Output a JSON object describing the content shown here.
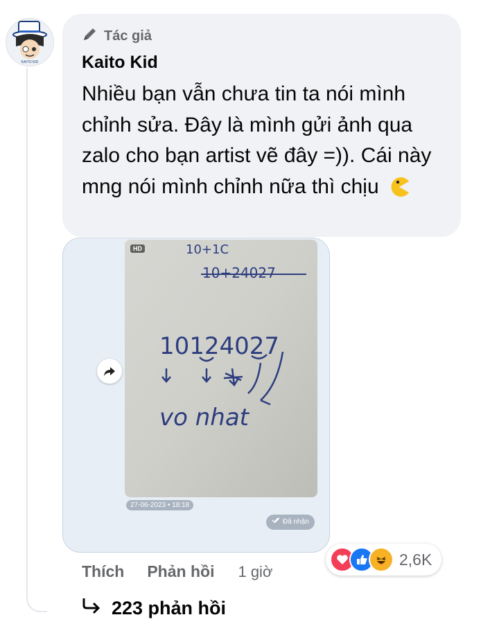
{
  "comment": {
    "badge_label": "Tác giả",
    "author_name": "Kaito Kid",
    "text": "Nhiều bạn vẫn chưa tin ta nói mình chỉnh sửa. Đây là mình gửi ảnh qua zalo cho bạn artist vẽ đây =)). Cái này mng nói mình chỉnh nữa thì chịu",
    "emoji": "pacman-face"
  },
  "attachment": {
    "hd_label": "HD",
    "photo_timestamp": "27-06-2023 • 18:18",
    "status_label": "Đã nhận",
    "handwriting": {
      "line1": "10+1C",
      "line2_strikethrough": "10+24027",
      "line3": "10124027",
      "line4": "vo nhat"
    }
  },
  "actions": {
    "like_label": "Thích",
    "reply_label": "Phản hồi",
    "time_ago": "1 giờ"
  },
  "reactions": {
    "count": "2,6K",
    "types": [
      "love",
      "like",
      "haha"
    ],
    "colors": {
      "love": "#f33e58",
      "like": "#1877f2",
      "haha": "#f7b125"
    }
  },
  "replies": {
    "label": "223 phản hồi"
  }
}
